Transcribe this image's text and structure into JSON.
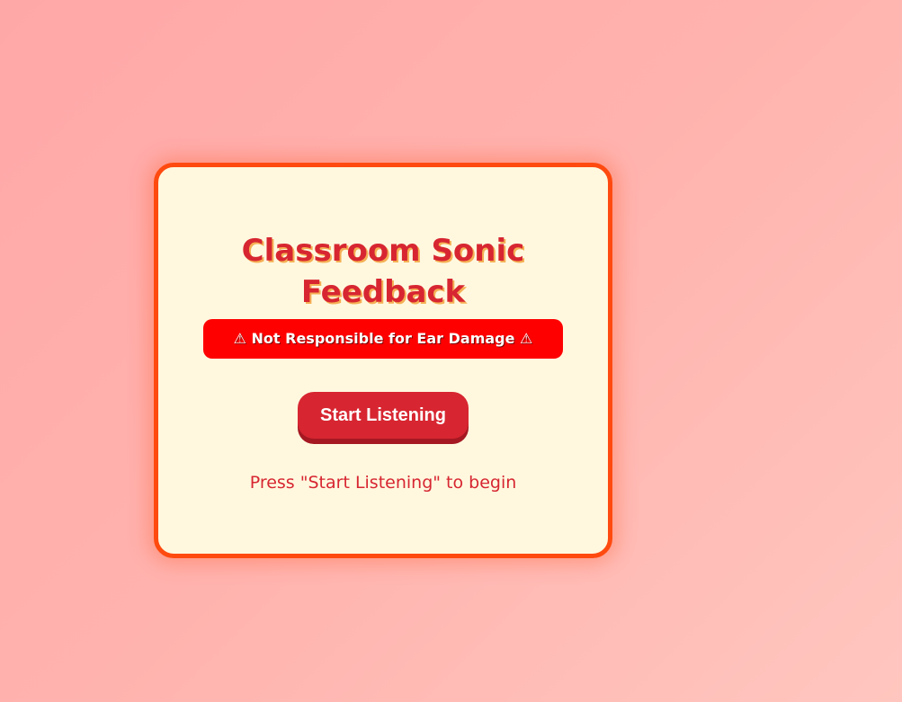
{
  "app": {
    "title_line1": "Classroom Sonic",
    "title_line2": "Feedback"
  },
  "warning": {
    "icon_left": "⚠",
    "text": "Not Responsible for Ear Damage",
    "icon_right": "⚠"
  },
  "controls": {
    "start_label": "Start Listening"
  },
  "status": {
    "message": "Press \"Start Listening\" to begin"
  },
  "colors": {
    "background_start": "#ffa8a8",
    "background_end": "#ffc6bf",
    "card_bg": "#fff8df",
    "card_border": "#ff4a0f",
    "accent": "#d72631",
    "warning_bg": "#ff0000",
    "title_shadow": "#f5b054"
  },
  "icons": {
    "warning": "warning-triangle-icon"
  }
}
